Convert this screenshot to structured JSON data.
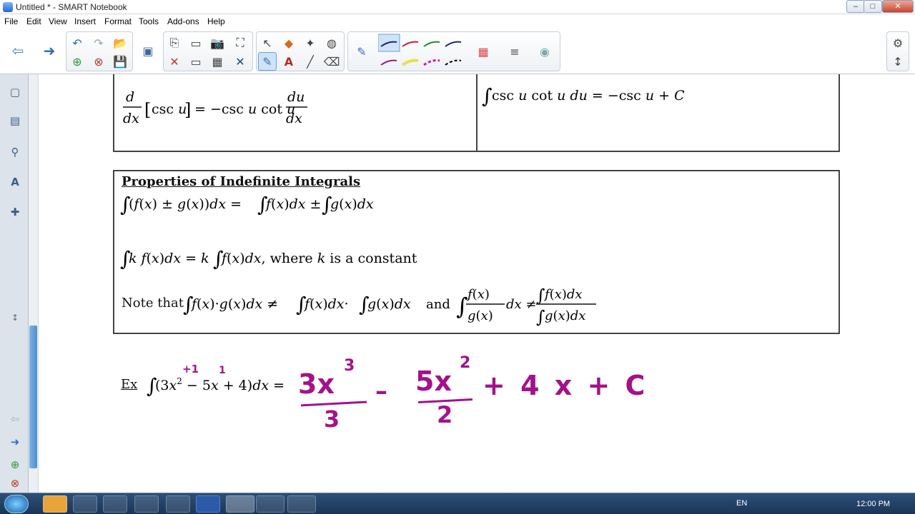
{
  "window": {
    "title": "Untitled * - SMART Notebook",
    "btn_min": "–",
    "btn_max": "□",
    "btn_close": "✕"
  },
  "menu": {
    "file": "File",
    "edit": "Edit",
    "view": "View",
    "insert": "Insert",
    "format": "Format",
    "tools": "Tools",
    "addons": "Add-ons",
    "help": "Help"
  },
  "icons": {
    "back": "⇦",
    "forward": "➜",
    "undo": "↶",
    "redo": "↷",
    "open": "📂",
    "addpage": "⊕",
    "deletepage": "⊗",
    "save": "💾",
    "screenshade": "▣",
    "paste": "⎘",
    "clear": "✕",
    "table": "▦",
    "screencap": "▭",
    "camera": "📷",
    "fullscreen": "⛶",
    "select": "↖",
    "shapes": "◆",
    "magic": "✦",
    "fill": "◍",
    "pen": "✎",
    "lines": "╱",
    "text": "A",
    "eraser": "⌫",
    "properties": "⚙",
    "move": "↕",
    "sidebar_page": "▢",
    "sidebar_gallery": "▤",
    "sidebar_attach": "⚲",
    "sidebar_props": "A",
    "sidebar_addons": "✚",
    "pen_thin": "✎",
    "grid": "▦",
    "widgets": "≡",
    "lens": "◉"
  },
  "colors": {
    "handwriting": "#a4128a",
    "border": "#444444",
    "taskbar": "#1f3b60"
  },
  "math": {
    "deriv_csc": "d/dx[csc u] = −csc u cot u du/dx",
    "int_csc": "∫csc u cot u du = −csc u + C",
    "props_title": "Properties of Indefinite Integrals",
    "prop1": "∫(f(x) ± g(x))dx = ∫f(x)dx ± ∫g(x)dx",
    "prop2": "∫k f(x)dx = k∫f(x)dx, where  k  is a constant",
    "note_label": "Note that",
    "note_prod": "∫f(x)·g(x)dx ≠ ∫f(x)dx·∫g(x)dx",
    "note_and": "and",
    "ex_label": "Ex",
    "ex_integral": "∫(3x² − 5x + 4)dx ="
  },
  "handwriting": {
    "exp_annot_1": "+1",
    "exp_annot_2": "1",
    "num1": "3x",
    "exp1": "3",
    "den1": "3",
    "minus": "–",
    "num2": "5x",
    "exp2": "2",
    "den2": "2",
    "rest": "+ 4 x + C"
  },
  "taskbar": {
    "lang": "EN",
    "clock": "12:00 PM"
  }
}
